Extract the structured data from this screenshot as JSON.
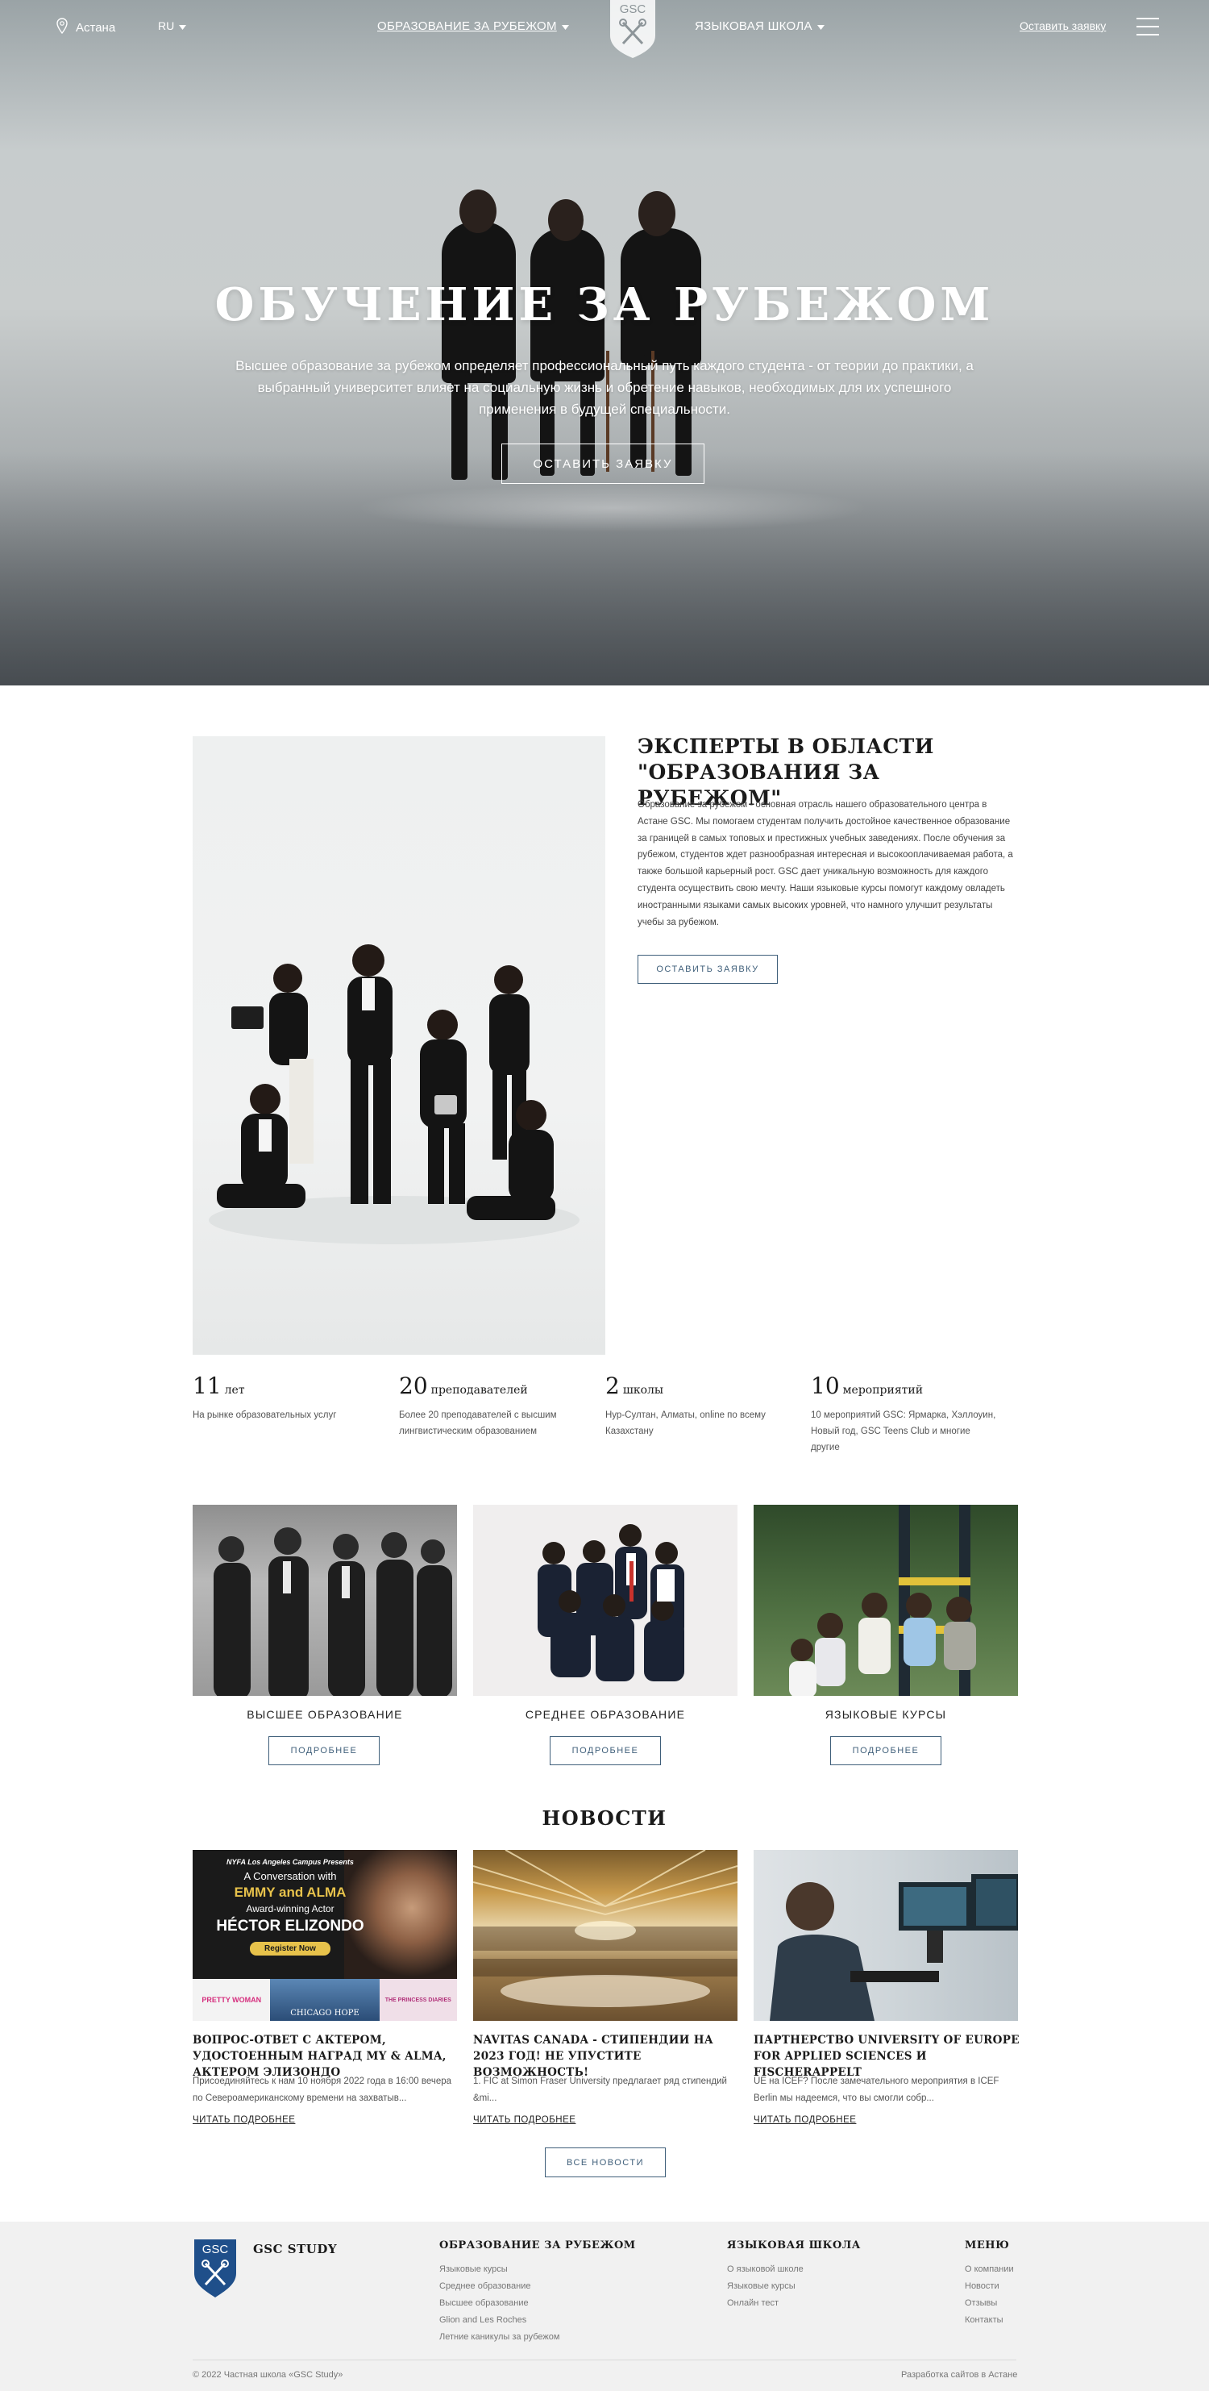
{
  "header": {
    "location": "Астана",
    "language": "RU",
    "nav_left": "ОБРАЗОВАНИЕ ЗА РУБЕЖОМ",
    "nav_right": "ЯЗЫКОВАЯ ШКОЛА",
    "logo_text": "GSC",
    "apply_link": "Оставить заявку"
  },
  "hero": {
    "title": "ОБУЧЕНИЕ ЗА РУБЕЖОМ",
    "text": "Высшее образование за рубежом определяет профессиональный путь каждого студента - от теории до практики, а выбранный университет влияет на социальную жизнь и обретение навыков, необходимых для их успешного применения в будущей специальности.",
    "button": "ОСТАВИТЬ ЗАЯВКУ"
  },
  "about": {
    "title": "ЭКСПЕРТЫ В ОБЛАСТИ \"ОБРАЗОВАНИЯ ЗА РУБЕЖОМ\"",
    "text": "Образование за рубежом - основная отрасль нашего образовательного центра в Астане GSC. Мы помогаем студентам получить достойное качественное образование за границей в самых топовых и престижных учебных заведениях. После обучения за рубежом, студентов ждет разнообразная интересная и высокооплачиваемая работа, а также большой карьерный рост. GSC дает уникальную возможность для каждого студента осуществить свою мечту. Наши языковые курсы помогут каждому овладеть иностранными языками самых высоких уровней, что намного улучшит результаты учебы за рубежом.",
    "button": "ОСТАВИТЬ ЗАЯВКУ"
  },
  "stats": [
    {
      "num": "11",
      "unit": "лет",
      "desc": "На рынке образовательных услуг"
    },
    {
      "num": "20",
      "unit": "преподавателей",
      "desc": "Более 20 преподавателей с высшим лингвистическим образованием"
    },
    {
      "num": "2",
      "unit": "школы",
      "desc": "Нур-Султан, Алматы, online по всему Казахстану"
    },
    {
      "num": "10",
      "unit": "мероприятий",
      "desc": "10 мероприятий GSC: Ярмарка, Хэллоуин, Новый год, GSC Teens Club и многие другие"
    }
  ],
  "programs": [
    {
      "title": "ВЫСШЕЕ ОБРАЗОВАНИЕ",
      "button": "ПОДРОБНЕЕ"
    },
    {
      "title": "СРЕДНЕЕ ОБРАЗОВАНИЕ",
      "button": "ПОДРОБНЕЕ"
    },
    {
      "title": "ЯЗЫКОВЫЕ КУРСЫ",
      "button": "ПОДРОБНЕЕ"
    }
  ],
  "news": {
    "heading": "НОВОСТИ",
    "items": [
      {
        "title": "ВОПРОС-ОТВЕТ С АКТЕРОМ, УДОСТОЕННЫМ НАГРАД MY & ALMA, АКТЕРОМ ЭЛИЗОНДО",
        "excerpt": "Присоединяйтесь к нам 10 ноября 2022 года в 16:00 вечера по Североамериканскому времени на захватыв...",
        "more": "ЧИТАТЬ ПОДРОБНЕЕ",
        "poster": {
          "line1": "NYFA Los Angeles Campus Presents",
          "line2": "A Conversation with",
          "line3": "EMMY and ALMA",
          "line4": "Award-winning Actor",
          "line5": "HÉCTOR ELIZONDO",
          "register": "Register Now",
          "film1": "PRETTY WOMAN",
          "film2": "CHICAGO HOPE",
          "film3": "THE PRINCESS DIARIES"
        }
      },
      {
        "title": "NAVITAS CANADA - СТИПЕНДИИ НА 2023 ГОД! НЕ УПУСТИТЕ ВОЗМОЖНОСТЬ!",
        "excerpt": "1.    FIC at Simon Fraser University предлагает ряд стипендий &mi...",
        "more": "ЧИТАТЬ ПОДРОБНЕЕ"
      },
      {
        "title": "ПАРТНЕРСТВО UNIVERSITY OF EUROPE FOR APPLIED SCIENCES И FISCHERAPPELT",
        "excerpt": " UE на ICEF? После замечательного мероприятия в ICEF Berlin мы надеемся, что вы смогли собр...",
        "more": "ЧИТАТЬ ПОДРОБНЕЕ"
      }
    ],
    "all_button": "ВСЕ НОВОСТИ"
  },
  "footer": {
    "brand": "GSC STUDY",
    "logo_text": "GSC",
    "col1": {
      "title": "ОБРАЗОВАНИЕ ЗА РУБЕЖОМ",
      "links": [
        "Языковые курсы",
        "Среднее образование",
        "Высшее образование",
        "Glion and Les Roches",
        "Летние каникулы за рубежом"
      ]
    },
    "col2": {
      "title": "ЯЗЫКОВАЯ ШКОЛА",
      "links": [
        "О языковой школе",
        "Языковые курсы",
        "Онлайн тест"
      ]
    },
    "col3": {
      "title": "МЕНЮ",
      "links": [
        "О компании",
        "Новости",
        "Отзывы",
        "Контакты"
      ]
    },
    "copyright": "© 2022 Частная школа «GSC Study»",
    "developer": "Разработка сайтов в Астане"
  },
  "colors": {
    "accent": "#3f5f7a",
    "footer_bg": "#f1f1f1",
    "logo_blue": "#1f4f8a"
  }
}
